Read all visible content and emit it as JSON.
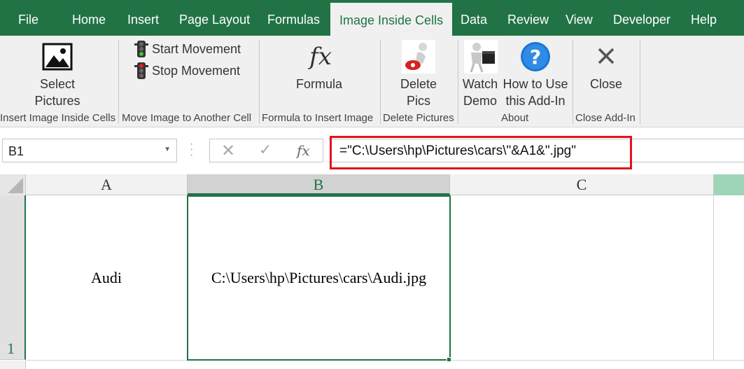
{
  "tabs": [
    "File",
    "Home",
    "Insert",
    "Page Layout",
    "Formulas",
    "Image Inside Cells",
    "Data",
    "Review",
    "View",
    "Developer",
    "Help"
  ],
  "ribbon": {
    "select_line1": "Select",
    "select_line2": "Pictures",
    "start_movement": "Start Movement",
    "stop_movement": "Stop Movement",
    "formula": "Formula",
    "delete_line1": "Delete",
    "delete_line2": "Pics",
    "watch_line1": "Watch",
    "watch_line2": "Demo",
    "howto_line1": "How to Use",
    "howto_line2": "this Add-In",
    "close": "Close",
    "fx_glyph": "fx",
    "groups": [
      "Insert Image Inside Cells",
      "Move Image to Another Cell",
      "Formula to Insert Image",
      "Delete Pictures",
      "About",
      "Close Add-In"
    ]
  },
  "formula_bar": {
    "name_box": "B1",
    "formula": "=\"C:\\Users\\hp\\Pictures\\cars\\\"&A1&\".jpg\"",
    "fx_glyph": "fx"
  },
  "grid": {
    "columns": [
      "A",
      "B",
      "C"
    ],
    "row_number": "1",
    "cells": {
      "A1": "Audi",
      "B1": "C:\\Users\\hp\\Pictures\\cars\\Audi.jpg",
      "C1": ""
    }
  },
  "colors": {
    "accent": "#217346",
    "highlight": "#e0141e"
  }
}
